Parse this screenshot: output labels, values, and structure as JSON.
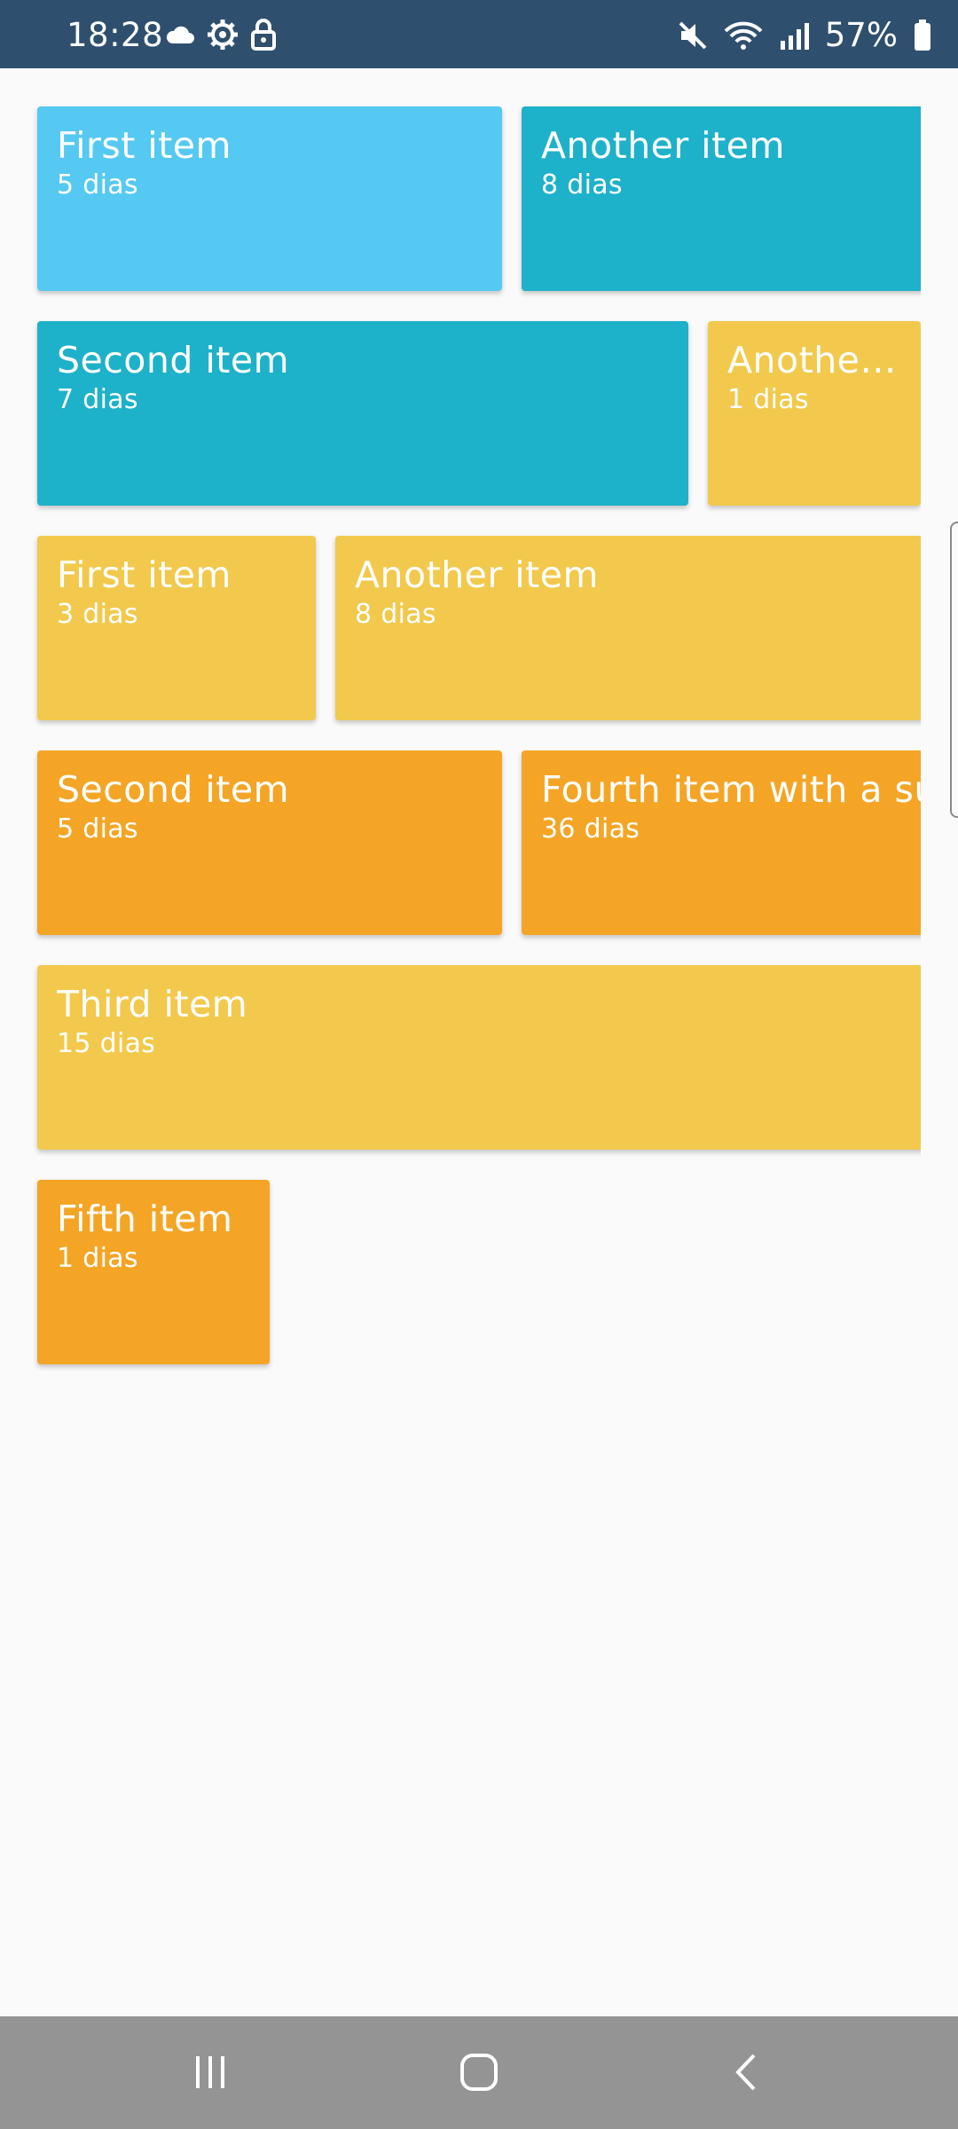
{
  "status_bar": {
    "time": "18:28",
    "battery": "57%",
    "left_icons": [
      "cloud-icon",
      "settings-gear-icon",
      "lock-icon"
    ],
    "right_icons": [
      "mute-icon",
      "wifi-icon",
      "signal-icon",
      "battery-icon"
    ]
  },
  "colors": {
    "light_blue": "#55c9f1",
    "cyan": "#1eb1ca",
    "yellow": "#f2c94c",
    "orange": "#f4a526",
    "status_bar": "#2f4f6e",
    "nav_bar": "#949494",
    "background": "#fafafa"
  },
  "tiles": [
    {
      "title": "First item",
      "subtitle": "5 dias",
      "color": "light_blue"
    },
    {
      "title": "Another item",
      "subtitle": "8 dias",
      "color": "cyan"
    },
    {
      "title": "Second item",
      "subtitle": "7 dias",
      "color": "cyan"
    },
    {
      "title": "Another item",
      "subtitle": "1 dias",
      "color": "yellow"
    },
    {
      "title": "First item",
      "subtitle": "3 dias",
      "color": "yellow"
    },
    {
      "title": "Another item",
      "subtitle": "8 dias",
      "color": "yellow"
    },
    {
      "title": "Second item",
      "subtitle": "5 dias",
      "color": "orange"
    },
    {
      "title": "Fourth item with a super long name",
      "subtitle": "36 dias",
      "color": "orange"
    },
    {
      "title": "Third item",
      "subtitle": "15 dias",
      "color": "yellow"
    },
    {
      "title": "Fifth item",
      "subtitle": "1 dias",
      "color": "orange"
    }
  ],
  "nav_bar": {
    "buttons": [
      "recents-button",
      "home-button",
      "back-button"
    ]
  }
}
